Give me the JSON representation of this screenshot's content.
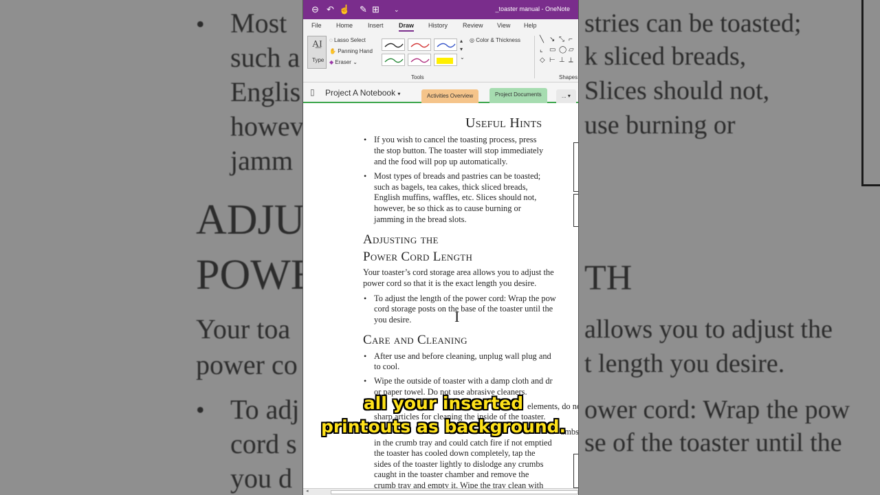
{
  "background": {
    "lines": [
      "Most",
      "stries can be toasted;",
      "such a",
      "k sliced breads,",
      "Englis",
      "Slices should not,",
      "howev",
      "use burning or",
      "jamm",
      "ADJU",
      "POWE",
      "TH",
      "Your toa",
      "allows you to adjust the",
      "power co",
      "t length you desire.",
      "To adj",
      "ower cord: Wrap the pow",
      "cord s",
      "se of the toaster until the",
      "you d"
    ]
  },
  "titlebar": {
    "title": "_toaster manual - OneNote",
    "color": "#7a2d8c"
  },
  "ribbon_tabs": [
    "File",
    "Home",
    "Insert",
    "Draw",
    "History",
    "Review",
    "View",
    "Help"
  ],
  "active_tab": "Draw",
  "ribbon": {
    "type_label": "Type",
    "lasso": "Lasso Select",
    "panning": "Panning Hand",
    "eraser": "Eraser",
    "color_thickness": "Color & Thickness",
    "tools_group": "Tools",
    "shapes_group": "Shapes"
  },
  "notebook": {
    "name": "Project A Notebook",
    "sections": [
      "Activities Overview",
      "Project Documents",
      "..."
    ]
  },
  "document": {
    "useful_hints_title": "Useful Hints",
    "hint1": [
      "If you wish to cancel the toasting process, press",
      "the stop button. The toaster will stop immediately",
      "and the food will pop up automatically."
    ],
    "hint2": [
      "Most types of breads and pastries can be toasted;",
      "such as bagels, tea cakes, thick sliced breads,",
      "English muffins, waffles, etc. Slices should not,",
      "however, be so thick as to cause burning or",
      "jamming in the bread slots."
    ],
    "adjust_title_1": "Adjusting the",
    "adjust_title_2": "Power Cord Length",
    "adjust_para": [
      "Your toaster’s cord storage area allows you to adjust the",
      "power cord so that it is the exact length you desire."
    ],
    "adjust_bullet": [
      "To adjust the length of the power cord: Wrap the pow",
      "cord storage posts on the base of the toaster until the",
      "you desire."
    ],
    "care_title": "Care and Cleaning",
    "care1": [
      "After use and before cleaning, unplug wall plug and ",
      "to cool."
    ],
    "care2": [
      "Wipe the outside of toaster with a damp cloth and dr",
      "or paper towel. Do not use abrasive cleaners."
    ],
    "care3": [
      "elements, do not",
      "sharp articles for cleaning the inside of the toaster."
    ],
    "care4": [
      "umbs",
      "in the crumb tray and could catch fire if not emptied",
      "the toaster has cooled down completely, tap the",
      "sides of the toaster lightly to dislodge any crumbs",
      "caught in the toaster chamber and remove the",
      "crumb tray and empty it. Wipe the tray clean with"
    ]
  },
  "caption": {
    "line1": "all your inserted",
    "line2": "printouts as background."
  }
}
